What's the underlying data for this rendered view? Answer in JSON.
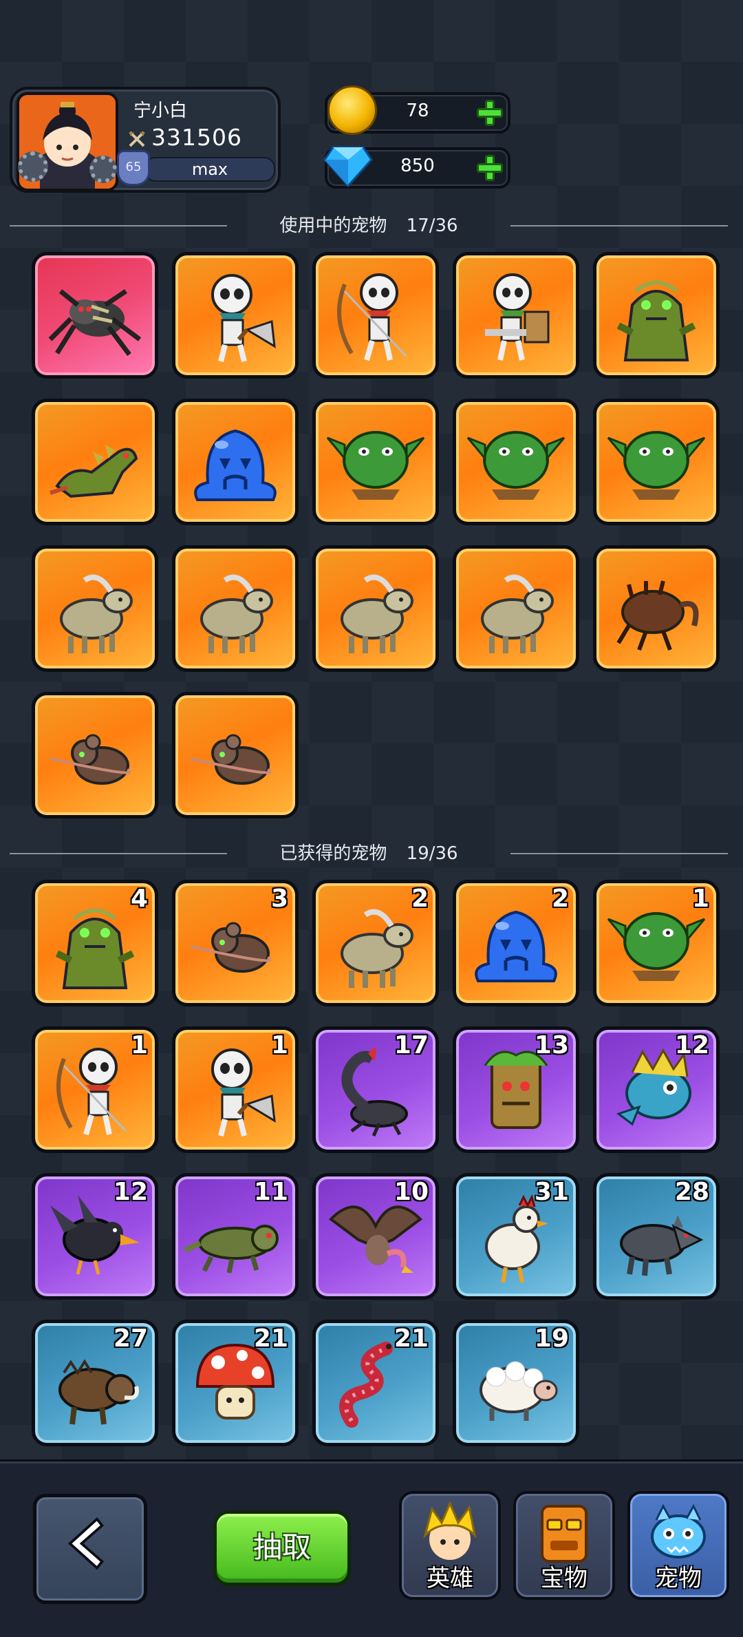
{
  "player": {
    "name": "宁小白",
    "power": "331506",
    "level": "65",
    "exp": "max"
  },
  "currency": {
    "gold": "78",
    "diamonds": "850"
  },
  "in_use": {
    "title": "使用中的宠物",
    "count": "17/36",
    "pets": [
      {
        "name": "spider",
        "rarity": "red"
      },
      {
        "name": "skeleton-axe",
        "rarity": "orange"
      },
      {
        "name": "skeleton-archer",
        "rarity": "orange"
      },
      {
        "name": "skeleton-shield",
        "rarity": "orange"
      },
      {
        "name": "swamp-zombie",
        "rarity": "orange"
      },
      {
        "name": "dragon",
        "rarity": "orange"
      },
      {
        "name": "blue-slime",
        "rarity": "orange"
      },
      {
        "name": "goblin",
        "rarity": "orange"
      },
      {
        "name": "goblin",
        "rarity": "orange"
      },
      {
        "name": "goblin",
        "rarity": "orange"
      },
      {
        "name": "goat",
        "rarity": "orange"
      },
      {
        "name": "goat",
        "rarity": "orange"
      },
      {
        "name": "goat",
        "rarity": "orange"
      },
      {
        "name": "goat",
        "rarity": "orange"
      },
      {
        "name": "beetle",
        "rarity": "orange"
      },
      {
        "name": "rat",
        "rarity": "orange"
      },
      {
        "name": "rat",
        "rarity": "orange"
      }
    ]
  },
  "obtained": {
    "title": "已获得的宠物",
    "count": "19/36",
    "pets": [
      {
        "name": "swamp-zombie",
        "rarity": "orange",
        "count": "4"
      },
      {
        "name": "rat",
        "rarity": "orange",
        "count": "3"
      },
      {
        "name": "goat",
        "rarity": "orange",
        "count": "2"
      },
      {
        "name": "blue-slime",
        "rarity": "orange",
        "count": "2"
      },
      {
        "name": "goblin",
        "rarity": "orange",
        "count": "1"
      },
      {
        "name": "skeleton-archer",
        "rarity": "orange",
        "count": "1"
      },
      {
        "name": "skeleton-axe",
        "rarity": "orange",
        "count": "1"
      },
      {
        "name": "scorpion",
        "rarity": "purple",
        "count": "17"
      },
      {
        "name": "tree-stump",
        "rarity": "purple",
        "count": "13"
      },
      {
        "name": "fish-monster",
        "rarity": "purple",
        "count": "12"
      },
      {
        "name": "crow",
        "rarity": "purple",
        "count": "12"
      },
      {
        "name": "lizard",
        "rarity": "purple",
        "count": "11"
      },
      {
        "name": "vulture",
        "rarity": "purple",
        "count": "10"
      },
      {
        "name": "rooster",
        "rarity": "blue",
        "count": "31"
      },
      {
        "name": "wolf",
        "rarity": "blue",
        "count": "28"
      },
      {
        "name": "boar",
        "rarity": "blue",
        "count": "27"
      },
      {
        "name": "mushroom",
        "rarity": "blue",
        "count": "21"
      },
      {
        "name": "worm",
        "rarity": "blue",
        "count": "21"
      },
      {
        "name": "sheep",
        "rarity": "blue",
        "count": "19"
      }
    ]
  },
  "bottom": {
    "draw_label": "抽取",
    "nav": [
      "英雄",
      "宝物",
      "宠物"
    ]
  }
}
